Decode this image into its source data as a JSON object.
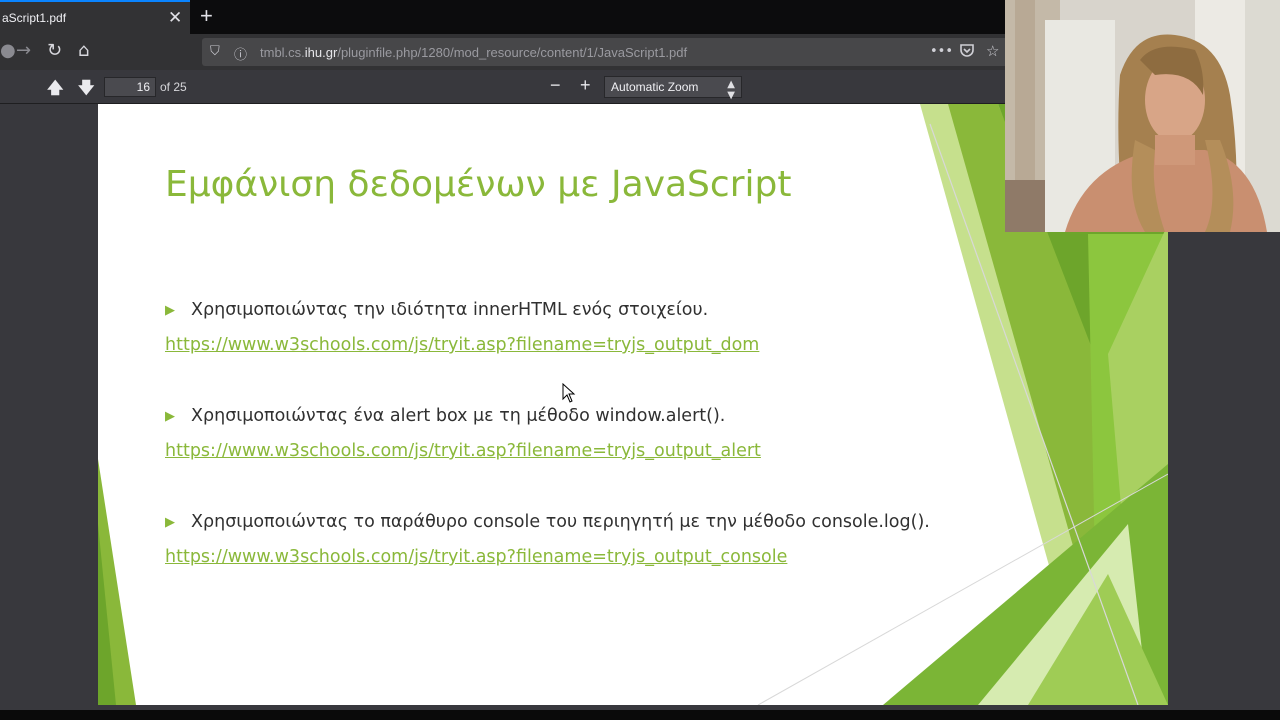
{
  "browser": {
    "tab_title": "aScript1.pdf",
    "tab_close": "✕",
    "new_tab": "+",
    "nav": {
      "back": "←",
      "forward": "→",
      "reload": "↻",
      "home": "⌂"
    },
    "url_prefix": "tmbl.cs.",
    "url_host_bold": "ihu.gr",
    "url_rest": "/pluginfile.php/1280/mod_resource/content/1/JavaScript1.pdf",
    "url_actions": [
      "•••",
      "pocket-icon",
      "bookmark-star-icon"
    ]
  },
  "pdf_toolbar": {
    "page_current": "16",
    "page_of": "of 25",
    "zoom_out": "−",
    "zoom_in": "+",
    "zoom_value": "Automatic Zoom"
  },
  "slide": {
    "title": "Εμφάνιση δεδομένων με JavaScript",
    "items": [
      {
        "text": "Χρησιμοποιώντας την ιδιότητα innerHTML ενός στοιχείου.",
        "link": "https://www.w3schools.com/js/tryit.asp?filename=tryjs_output_dom"
      },
      {
        "text": "Χρησιμοποιώντας ένα alert box με τη μέθοδο window.alert().",
        "link": "https://www.w3schools.com/js/tryit.asp?filename=tryjs_output_alert"
      },
      {
        "text": "Χρησιμοποιώντας το παράθυρο console του περιηγητή με την μέθοδο console.log().",
        "link": "https://www.w3schools.com/js/tryit.asp?filename=tryjs_output_console"
      }
    ],
    "bullet_glyph": "▶",
    "accent_color": "#8ab83a"
  },
  "colors": {
    "tab_accent": "#0a84ff",
    "toolbar_bg": "#38383d",
    "slide_green": "#8ab83a"
  }
}
